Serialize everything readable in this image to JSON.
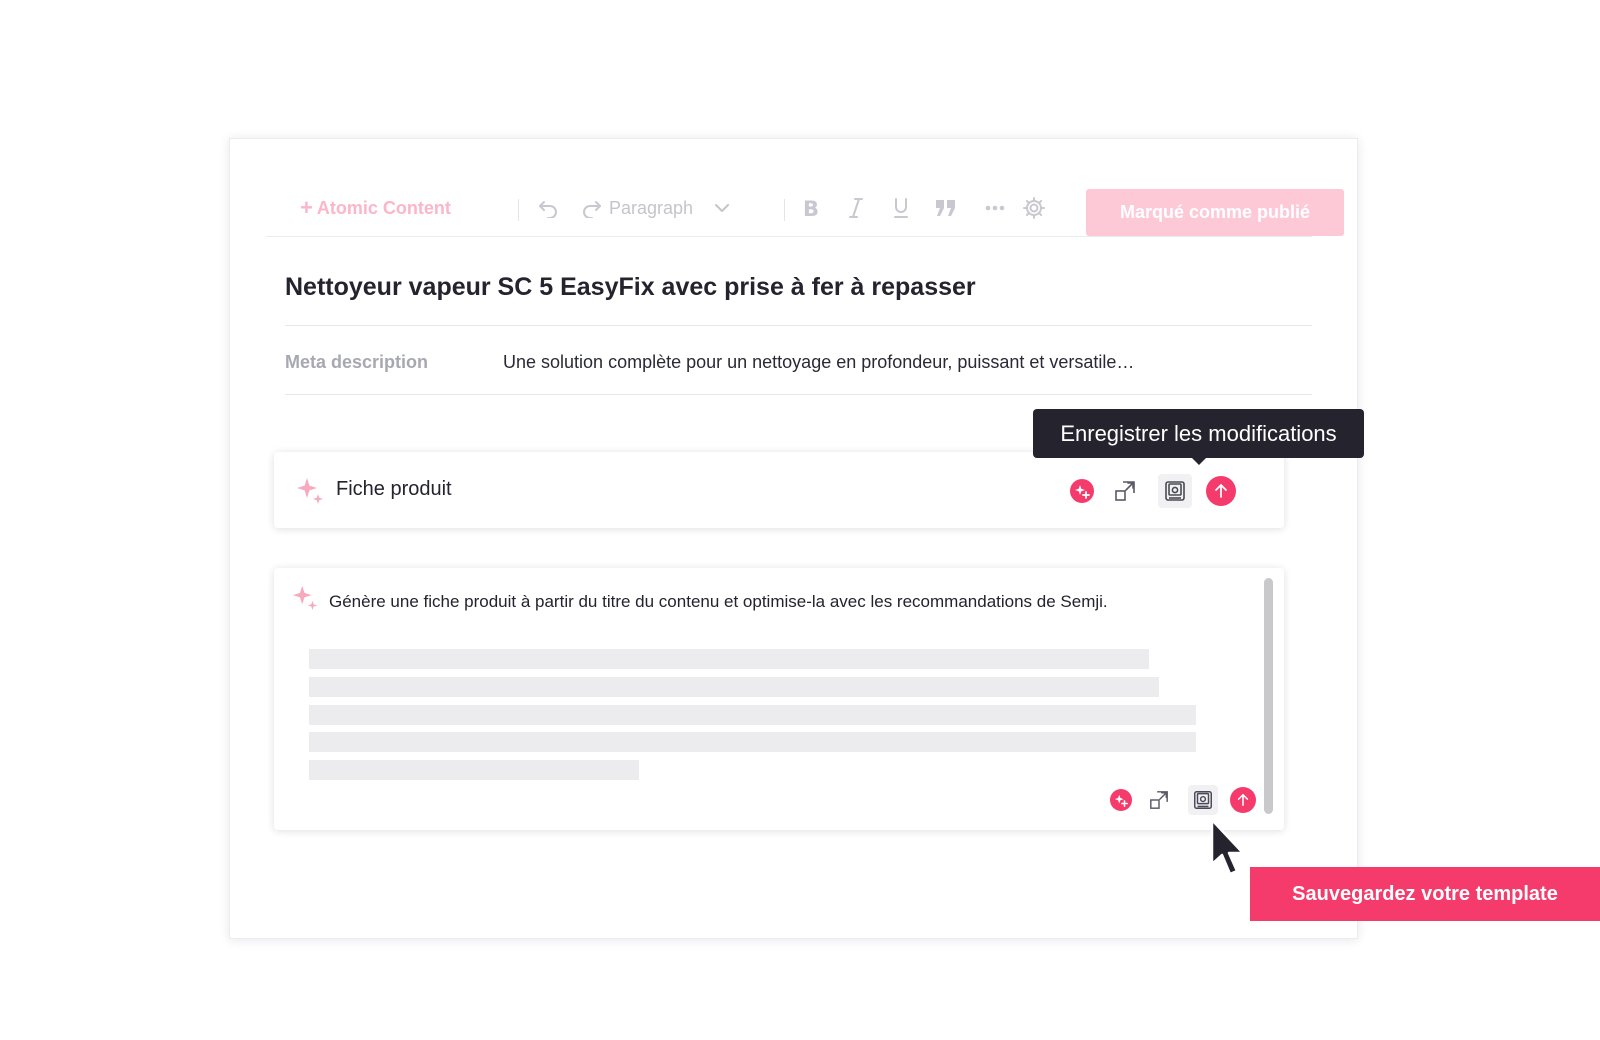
{
  "toolbar": {
    "atomic_plus": "+",
    "atomic_label": "Atomic Content",
    "paragraph_label": "Paragraph",
    "publish_label": "Marqué  comme publié",
    "icons": [
      "undo-icon",
      "redo-icon",
      "chevron-down-icon",
      "bold-icon",
      "italic-icon",
      "underline-icon",
      "quote-icon",
      "more-icon",
      "settings-icon"
    ]
  },
  "document": {
    "title": "Nettoyeur vapeur SC 5 EasyFix avec prise à fer à repasser",
    "meta_label": "Meta description",
    "meta_value": "Une solution complète pour un nettoyage en profondeur, puissant et versatile…"
  },
  "block_template": {
    "label": "Fiche produit",
    "actions": [
      "ai-generate-icon",
      "expand-icon",
      "save-icon",
      "publish-up-icon"
    ]
  },
  "block_prompt": {
    "prompt": "Génère une fiche produit à partir du titre du contenu et optimise-la avec les recommandations de Semji.",
    "skeleton_lines": 5,
    "actions": [
      "ai-generate-icon",
      "expand-icon",
      "save-icon",
      "publish-up-icon"
    ]
  },
  "tooltip": {
    "text": "Enregistrer les modifications"
  },
  "cta": {
    "label": "Sauvegardez votre template"
  },
  "colors": {
    "accent": "#f53b6b",
    "accent_light": "#fdc9d6",
    "dark": "#24232e",
    "muted": "#a8a8b2",
    "skeleton": "#ececee"
  }
}
